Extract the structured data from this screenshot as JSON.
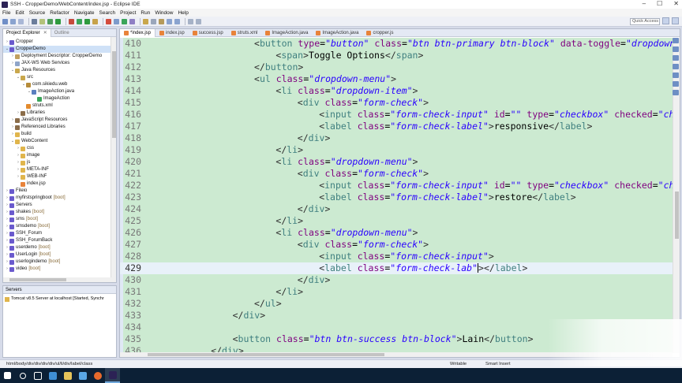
{
  "window": {
    "title": "SSH - CropperDemo/WebContent/index.jsp - Eclipse IDE",
    "minimize": "–",
    "maximize": "☐",
    "close": "✕"
  },
  "menu": [
    "File",
    "Edit",
    "Source",
    "Refactor",
    "Navigate",
    "Search",
    "Project",
    "Run",
    "Window",
    "Help"
  ],
  "toolbar": {
    "quick_access": "Quick Access"
  },
  "explorer": {
    "tab_project": "Project Explorer",
    "tab_outline": "Outline",
    "items": [
      {
        "label": "Cropper",
        "indent": 0,
        "arrow": "›",
        "color": "#6a5acd",
        "boot": ""
      },
      {
        "label": "CropperDemo",
        "indent": 0,
        "arrow": "⌄",
        "color": "#6a5acd",
        "boot": "",
        "selected": true
      },
      {
        "label": "Deployment Descriptor: CropperDemo",
        "indent": 1,
        "arrow": "›",
        "color": "#c0a060",
        "boot": ""
      },
      {
        "label": "JAX-WS Web Services",
        "indent": 1,
        "arrow": "›",
        "color": "#8fa5c9",
        "boot": ""
      },
      {
        "label": "Java Resources",
        "indent": 1,
        "arrow": "⌄",
        "color": "#c9a74c",
        "boot": ""
      },
      {
        "label": "src",
        "indent": 2,
        "arrow": "⌄",
        "color": "#c9a74c",
        "boot": ""
      },
      {
        "label": "com.sikiedu.web",
        "indent": 3,
        "arrow": "⌄",
        "color": "#b68c3a",
        "boot": ""
      },
      {
        "label": "ImageAction.java",
        "indent": 4,
        "arrow": "⌄",
        "color": "#5b7fbf",
        "boot": ""
      },
      {
        "label": "ImageAction",
        "indent": 5,
        "arrow": "",
        "color": "#3aa55a",
        "boot": ""
      },
      {
        "label": "struts.xml",
        "indent": 3,
        "arrow": "",
        "color": "#e38b2e",
        "boot": ""
      },
      {
        "label": "Libraries",
        "indent": 2,
        "arrow": "›",
        "color": "#8b6d4a",
        "boot": ""
      },
      {
        "label": "JavaScript Resources",
        "indent": 1,
        "arrow": "›",
        "color": "#8b6d4a",
        "boot": ""
      },
      {
        "label": "Referenced Libraries",
        "indent": 1,
        "arrow": "›",
        "color": "#8b6d4a",
        "boot": ""
      },
      {
        "label": "build",
        "indent": 1,
        "arrow": "›",
        "color": "#e0b54c",
        "boot": ""
      },
      {
        "label": "WebContent",
        "indent": 1,
        "arrow": "⌄",
        "color": "#e0b54c",
        "boot": ""
      },
      {
        "label": "css",
        "indent": 2,
        "arrow": "›",
        "color": "#e0b54c",
        "boot": ""
      },
      {
        "label": "image",
        "indent": 2,
        "arrow": "›",
        "color": "#e0b54c",
        "boot": ""
      },
      {
        "label": "js",
        "indent": 2,
        "arrow": "›",
        "color": "#e0b54c",
        "boot": ""
      },
      {
        "label": "META-INF",
        "indent": 2,
        "arrow": "›",
        "color": "#e0b54c",
        "boot": ""
      },
      {
        "label": "WEB-INF",
        "indent": 2,
        "arrow": "›",
        "color": "#e0b54c",
        "boot": ""
      },
      {
        "label": "index.jsp",
        "indent": 2,
        "arrow": "",
        "color": "#e8833a",
        "boot": ""
      },
      {
        "label": "Fileio",
        "indent": 0,
        "arrow": "›",
        "color": "#6a5acd",
        "boot": ""
      },
      {
        "label": "myfirstspringboot",
        "indent": 0,
        "arrow": "›",
        "color": "#6a5acd",
        "boot": "[boot]"
      },
      {
        "label": "Servers",
        "indent": 0,
        "arrow": "›",
        "color": "#6a5acd",
        "boot": ""
      },
      {
        "label": "shakes",
        "indent": 0,
        "arrow": "›",
        "color": "#6a5acd",
        "boot": "[boot]"
      },
      {
        "label": "sms",
        "indent": 0,
        "arrow": "›",
        "color": "#6a5acd",
        "boot": "[boot]"
      },
      {
        "label": "smsdemo",
        "indent": 0,
        "arrow": "›",
        "color": "#6a5acd",
        "boot": "[boot]"
      },
      {
        "label": "SSH_Forum",
        "indent": 0,
        "arrow": "›",
        "color": "#6a5acd",
        "boot": ""
      },
      {
        "label": "SSH_ForumBack",
        "indent": 0,
        "arrow": "›",
        "color": "#6a5acd",
        "boot": ""
      },
      {
        "label": "userdemo",
        "indent": 0,
        "arrow": "›",
        "color": "#6a5acd",
        "boot": "[boot]"
      },
      {
        "label": "UserLogin",
        "indent": 0,
        "arrow": "›",
        "color": "#6a5acd",
        "boot": "[boot]"
      },
      {
        "label": "userlogindemo",
        "indent": 0,
        "arrow": "›",
        "color": "#6a5acd",
        "boot": "[boot]"
      },
      {
        "label": "video",
        "indent": 0,
        "arrow": "›",
        "color": "#6a5acd",
        "boot": "[boot]"
      }
    ]
  },
  "servers": {
    "tab": "Servers",
    "row": "Tomcat v8.5 Server at localhost  [Started, Synchr"
  },
  "editor": {
    "tabs": [
      {
        "label": "*index.jsp",
        "active": true
      },
      {
        "label": "index.jsp",
        "active": false
      },
      {
        "label": "success.jsp",
        "active": false
      },
      {
        "label": "struts.xml",
        "active": false
      },
      {
        "label": "ImageAction.java",
        "active": false
      },
      {
        "label": "ImageAction.java",
        "active": false
      },
      {
        "label": "cropper.js",
        "active": false
      }
    ],
    "current_line": 429,
    "lines": [
      {
        "n": 410,
        "i": 5,
        "parts": [
          [
            "t",
            "<"
          ],
          [
            "tn",
            "button"
          ],
          [
            "tx",
            " "
          ],
          [
            "an",
            "type"
          ],
          [
            "tx",
            "="
          ],
          [
            "av",
            "\"button\""
          ],
          [
            "tx",
            " "
          ],
          [
            "an",
            "class"
          ],
          [
            "tx",
            "="
          ],
          [
            "av",
            "\"btn btn-primary btn-block\""
          ],
          [
            "tx",
            " "
          ],
          [
            "an",
            "data-toggle"
          ],
          [
            "tx",
            "="
          ],
          [
            "av",
            "\"dropdown\""
          ]
        ]
      },
      {
        "n": 411,
        "i": 6,
        "parts": [
          [
            "t",
            "<"
          ],
          [
            "tn",
            "span"
          ],
          [
            "t",
            ">"
          ],
          [
            "tx",
            "Toggle Options"
          ],
          [
            "t",
            "</"
          ],
          [
            "tn",
            "span"
          ],
          [
            "t",
            ">"
          ]
        ]
      },
      {
        "n": 412,
        "i": 5,
        "parts": [
          [
            "t",
            "</"
          ],
          [
            "tn",
            "button"
          ],
          [
            "t",
            ">"
          ]
        ]
      },
      {
        "n": 413,
        "i": 5,
        "parts": [
          [
            "t",
            "<"
          ],
          [
            "tn",
            "ul"
          ],
          [
            "tx",
            " "
          ],
          [
            "an",
            "class"
          ],
          [
            "tx",
            "="
          ],
          [
            "av",
            "\"dropdown-menu\""
          ],
          [
            "t",
            ">"
          ]
        ]
      },
      {
        "n": 414,
        "i": 6,
        "parts": [
          [
            "t",
            "<"
          ],
          [
            "tn",
            "li"
          ],
          [
            "tx",
            " "
          ],
          [
            "an",
            "class"
          ],
          [
            "tx",
            "="
          ],
          [
            "av",
            "\"dropdown-item\""
          ],
          [
            "t",
            ">"
          ]
        ]
      },
      {
        "n": 415,
        "i": 7,
        "parts": [
          [
            "t",
            "<"
          ],
          [
            "tn",
            "div"
          ],
          [
            "tx",
            " "
          ],
          [
            "an",
            "class"
          ],
          [
            "tx",
            "="
          ],
          [
            "av",
            "\"form-check\""
          ],
          [
            "t",
            ">"
          ]
        ]
      },
      {
        "n": 416,
        "i": 8,
        "parts": [
          [
            "t",
            "<"
          ],
          [
            "tn",
            "input"
          ],
          [
            "tx",
            " "
          ],
          [
            "an",
            "class"
          ],
          [
            "tx",
            "="
          ],
          [
            "av",
            "\"form-check-input\""
          ],
          [
            "tx",
            " "
          ],
          [
            "an",
            "id"
          ],
          [
            "tx",
            "="
          ],
          [
            "av",
            "\"\""
          ],
          [
            "tx",
            " "
          ],
          [
            "an",
            "type"
          ],
          [
            "tx",
            "="
          ],
          [
            "av",
            "\"checkbox\""
          ],
          [
            "tx",
            " "
          ],
          [
            "an",
            "checked"
          ],
          [
            "tx",
            "="
          ],
          [
            "av",
            "\"ch"
          ]
        ]
      },
      {
        "n": 417,
        "i": 8,
        "parts": [
          [
            "t",
            "<"
          ],
          [
            "tn",
            "label"
          ],
          [
            "tx",
            " "
          ],
          [
            "an",
            "class"
          ],
          [
            "tx",
            "="
          ],
          [
            "av",
            "\"form-check-label\""
          ],
          [
            "t",
            ">"
          ],
          [
            "tx",
            "responsive"
          ],
          [
            "t",
            "</"
          ],
          [
            "tn",
            "label"
          ],
          [
            "t",
            ">"
          ]
        ]
      },
      {
        "n": 418,
        "i": 7,
        "parts": [
          [
            "t",
            "</"
          ],
          [
            "tn",
            "div"
          ],
          [
            "t",
            ">"
          ]
        ]
      },
      {
        "n": 419,
        "i": 6,
        "parts": [
          [
            "t",
            "</"
          ],
          [
            "tn",
            "li"
          ],
          [
            "t",
            ">"
          ]
        ]
      },
      {
        "n": 420,
        "i": 6,
        "parts": [
          [
            "t",
            "<"
          ],
          [
            "tn",
            "li"
          ],
          [
            "tx",
            " "
          ],
          [
            "an",
            "class"
          ],
          [
            "tx",
            "="
          ],
          [
            "av",
            "\"dropdown-menu\""
          ],
          [
            "t",
            ">"
          ]
        ]
      },
      {
        "n": 421,
        "i": 7,
        "parts": [
          [
            "t",
            "<"
          ],
          [
            "tn",
            "div"
          ],
          [
            "tx",
            " "
          ],
          [
            "an",
            "class"
          ],
          [
            "tx",
            "="
          ],
          [
            "av",
            "\"form-check\""
          ],
          [
            "t",
            ">"
          ]
        ]
      },
      {
        "n": 422,
        "i": 8,
        "parts": [
          [
            "t",
            "<"
          ],
          [
            "tn",
            "input"
          ],
          [
            "tx",
            " "
          ],
          [
            "an",
            "class"
          ],
          [
            "tx",
            "="
          ],
          [
            "av",
            "\"form-check-input\""
          ],
          [
            "tx",
            " "
          ],
          [
            "an",
            "id"
          ],
          [
            "tx",
            "="
          ],
          [
            "av",
            "\"\""
          ],
          [
            "tx",
            " "
          ],
          [
            "an",
            "type"
          ],
          [
            "tx",
            "="
          ],
          [
            "av",
            "\"checkbox\""
          ],
          [
            "tx",
            " "
          ],
          [
            "an",
            "checked"
          ],
          [
            "tx",
            "="
          ],
          [
            "av",
            "\"ch"
          ]
        ]
      },
      {
        "n": 423,
        "i": 8,
        "parts": [
          [
            "t",
            "<"
          ],
          [
            "tn",
            "label"
          ],
          [
            "tx",
            " "
          ],
          [
            "an",
            "class"
          ],
          [
            "tx",
            "="
          ],
          [
            "av",
            "\"form-check-label\""
          ],
          [
            "t",
            ">"
          ],
          [
            "tx",
            "restore"
          ],
          [
            "t",
            "</"
          ],
          [
            "tn",
            "label"
          ],
          [
            "t",
            ">"
          ]
        ]
      },
      {
        "n": 424,
        "i": 7,
        "parts": [
          [
            "t",
            "</"
          ],
          [
            "tn",
            "div"
          ],
          [
            "t",
            ">"
          ]
        ]
      },
      {
        "n": 425,
        "i": 6,
        "parts": [
          [
            "t",
            "</"
          ],
          [
            "tn",
            "li"
          ],
          [
            "t",
            ">"
          ]
        ]
      },
      {
        "n": 426,
        "i": 6,
        "parts": [
          [
            "t",
            "<"
          ],
          [
            "tn",
            "li"
          ],
          [
            "tx",
            " "
          ],
          [
            "an",
            "class"
          ],
          [
            "tx",
            "="
          ],
          [
            "av",
            "\"dropdown-menu\""
          ],
          [
            "t",
            ">"
          ]
        ]
      },
      {
        "n": 427,
        "i": 7,
        "parts": [
          [
            "t",
            "<"
          ],
          [
            "tn",
            "div"
          ],
          [
            "tx",
            " "
          ],
          [
            "an",
            "class"
          ],
          [
            "tx",
            "="
          ],
          [
            "av",
            "\"form-check\""
          ],
          [
            "t",
            ">"
          ]
        ]
      },
      {
        "n": 428,
        "i": 8,
        "parts": [
          [
            "t",
            "<"
          ],
          [
            "tn",
            "input"
          ],
          [
            "tx",
            " "
          ],
          [
            "an",
            "class"
          ],
          [
            "tx",
            "="
          ],
          [
            "av",
            "\"form-check-input\""
          ],
          [
            "t",
            ">"
          ]
        ]
      },
      {
        "n": 429,
        "i": 8,
        "parts": [
          [
            "t",
            "<"
          ],
          [
            "tn",
            "label"
          ],
          [
            "tx",
            " "
          ],
          [
            "an",
            "class"
          ],
          [
            "tx",
            "="
          ],
          [
            "av",
            "\"form-check-lab\""
          ],
          [
            "caret",
            ""
          ],
          [
            "t",
            ">"
          ],
          [
            "t",
            "</"
          ],
          [
            "tn",
            "label"
          ],
          [
            "t",
            ">"
          ]
        ]
      },
      {
        "n": 430,
        "i": 7,
        "parts": [
          [
            "t",
            "</"
          ],
          [
            "tn",
            "div"
          ],
          [
            "t",
            ">"
          ]
        ]
      },
      {
        "n": 431,
        "i": 6,
        "parts": [
          [
            "t",
            "</"
          ],
          [
            "tn",
            "li"
          ],
          [
            "t",
            ">"
          ]
        ]
      },
      {
        "n": 432,
        "i": 5,
        "parts": [
          [
            "t",
            "</"
          ],
          [
            "tn",
            "ul"
          ],
          [
            "t",
            ">"
          ]
        ]
      },
      {
        "n": 433,
        "i": 4,
        "parts": [
          [
            "t",
            "</"
          ],
          [
            "tn",
            "div"
          ],
          [
            "t",
            ">"
          ]
        ]
      },
      {
        "n": 434,
        "i": 0,
        "parts": []
      },
      {
        "n": 435,
        "i": 4,
        "parts": [
          [
            "t",
            "<"
          ],
          [
            "tn",
            "button"
          ],
          [
            "tx",
            " "
          ],
          [
            "an",
            "class"
          ],
          [
            "tx",
            "="
          ],
          [
            "av",
            "\"btn btn-success btn-block\""
          ],
          [
            "t",
            ">"
          ],
          [
            "tx",
            "Lain"
          ],
          [
            "t",
            "</"
          ],
          [
            "tn",
            "button"
          ],
          [
            "t",
            ">"
          ]
        ]
      },
      {
        "n": 436,
        "i": 3,
        "parts": [
          [
            "t",
            "</"
          ],
          [
            "tn",
            "div"
          ],
          [
            "t",
            ">"
          ]
        ]
      }
    ]
  },
  "status": {
    "path": "html/body/div/div/div/div/ul/li/div/label/class",
    "mode": "Writable",
    "insert": "Smart Insert",
    "position": "429 : 54 : 16941"
  }
}
